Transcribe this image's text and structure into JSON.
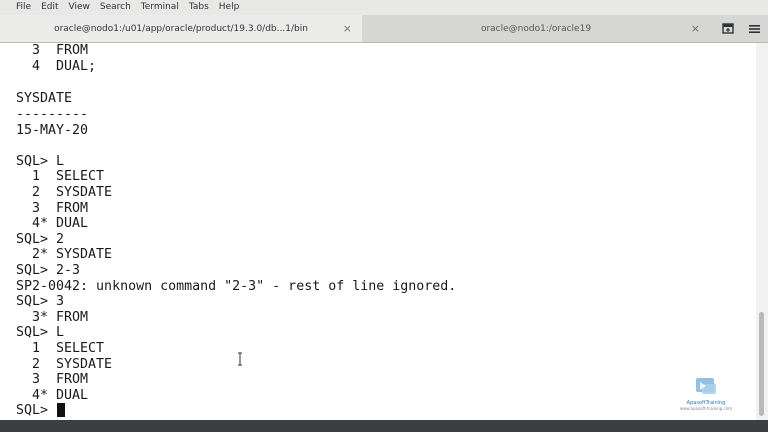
{
  "menubar": {
    "items": [
      "File",
      "Edit",
      "View",
      "Search",
      "Terminal",
      "Tabs",
      "Help"
    ]
  },
  "tabs": [
    {
      "label": "oracle@nodo1:/u01/app/oracle/product/19.3.0/db...1/bin",
      "active": true
    },
    {
      "label": "oracle@nodo1:/oracle19",
      "active": false
    }
  ],
  "terminal": {
    "lines": [
      "  3  FROM",
      "  4  DUAL;",
      "",
      "SYSDATE",
      "---------",
      "15-MAY-20",
      "",
      "SQL> L",
      "  1  SELECT",
      "  2  SYSDATE",
      "  3  FROM",
      "  4* DUAL",
      "SQL> 2",
      "  2* SYSDATE",
      "SQL> 2-3",
      "SP2-0042: unknown command \"2-3\" - rest of line ignored.",
      "SQL> 3",
      "  3* FROM",
      "SQL> L",
      "  1  SELECT",
      "  2  SYSDATE",
      "  3  FROM",
      "  4* DUAL",
      "SQL> "
    ]
  },
  "watermark": {
    "name": "ApasoftTraining",
    "url": "www.apasoft-training.com"
  },
  "colors": {
    "terminal_bg": "#ffffff",
    "terminal_fg": "#1a1a1a",
    "menubar_bg": "#e8e8e7",
    "tabbar_bg": "#d6d6d4"
  },
  "icons": {
    "close": "close-icon",
    "new_tab": "new-tab-icon",
    "menu": "hamburger-menu-icon"
  }
}
